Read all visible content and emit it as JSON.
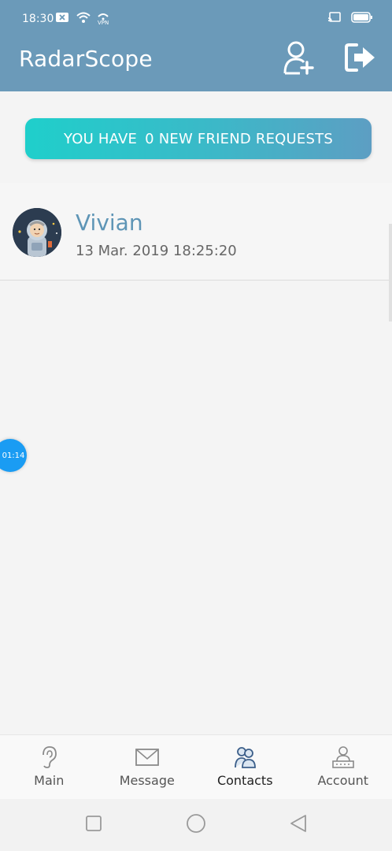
{
  "status_bar": {
    "time": "18:30",
    "vpn_label": "VPN",
    "icons": [
      "x-box-icon",
      "wifi-icon",
      "vpn-icon",
      "cast-icon",
      "battery-icon"
    ]
  },
  "app_bar": {
    "title": "RadarScope",
    "actions": [
      "add-friend-icon",
      "logout-icon"
    ]
  },
  "banner": {
    "prefix": "YOU HAVE",
    "count": "0",
    "suffix": "NEW FRIEND REQUESTS"
  },
  "contacts": [
    {
      "name": "Vivian",
      "last_seen": "13 Mar. 2019 18:25:20",
      "avatar": "astronaut-avatar"
    }
  ],
  "floating_timer": {
    "label": "01:14"
  },
  "bottom_nav": {
    "items": [
      {
        "label": "Main",
        "icon": "ear-icon"
      },
      {
        "label": "Message",
        "icon": "envelope-icon"
      },
      {
        "label": "Contacts",
        "icon": "contacts-icon"
      },
      {
        "label": "Account",
        "icon": "account-icon"
      }
    ],
    "active_index": 2
  },
  "colors": {
    "app_bar": "#6b9ab9",
    "banner_start": "#1fcfcb",
    "banner_end": "#5d9ec3",
    "accent_name": "#5e95b6",
    "timer_bubble": "#1a9cf3"
  }
}
